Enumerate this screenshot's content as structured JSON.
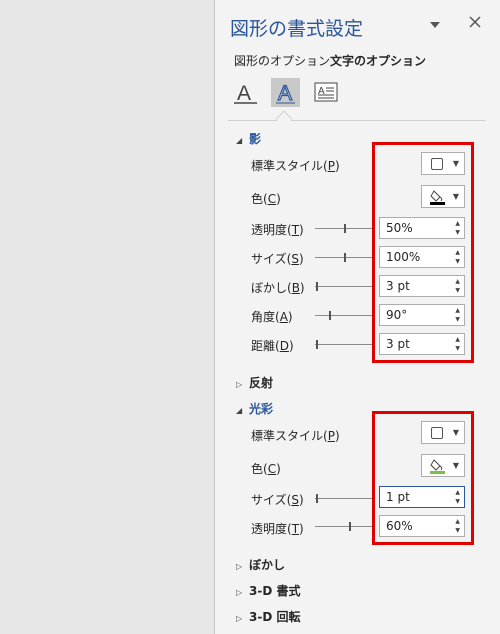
{
  "header": {
    "title": "図形の書式設定",
    "dropdown_icon": "triangle-down-icon",
    "close_icon": "close-icon"
  },
  "tabs": [
    {
      "label": "図形のオプション",
      "active": false
    },
    {
      "label": "文字のオプション",
      "active": true
    }
  ],
  "icon_tabs": [
    "text-fill-outline-icon",
    "text-effects-icon",
    "text-box-layout-icon"
  ],
  "sections": {
    "shadow": {
      "title": "影",
      "preset": {
        "label": "標準スタイル(",
        "key": "P",
        "suffix": ")"
      },
      "color": {
        "label": "色(",
        "key": "C",
        "suffix": ")",
        "swatch": "#000000"
      },
      "transparency": {
        "label": "透明度(",
        "key": "T",
        "suffix": ")",
        "value": "50%"
      },
      "size": {
        "label": "サイズ(",
        "key": "S",
        "suffix": ")",
        "value": "100%"
      },
      "blur": {
        "label": "ぼかし(",
        "key": "B",
        "suffix": ")",
        "value": "3 pt"
      },
      "angle": {
        "label": "角度(",
        "key": "A",
        "suffix": ")",
        "value": "90°"
      },
      "distance": {
        "label": "距離(",
        "key": "D",
        "suffix": ")",
        "value": "3 pt"
      }
    },
    "reflection": {
      "title": "反射"
    },
    "glow": {
      "title": "光彩",
      "preset": {
        "label": "標準スタイル(",
        "key": "P",
        "suffix": ")"
      },
      "color": {
        "label": "色(",
        "key": "C",
        "suffix": ")",
        "swatch": "#7ac143"
      },
      "size": {
        "label": "サイズ(",
        "key": "S",
        "suffix": ")",
        "value": "1 pt"
      },
      "transparency": {
        "label": "透明度(",
        "key": "T",
        "suffix": ")",
        "value": "60%"
      }
    },
    "soft_edges": {
      "title": "ぼかし"
    },
    "format_3d": {
      "title": "3-D 書式"
    },
    "rotation_3d": {
      "title": "3-D 回転"
    }
  },
  "highlight_color": "#e00000",
  "accent_color": "#2b579a"
}
